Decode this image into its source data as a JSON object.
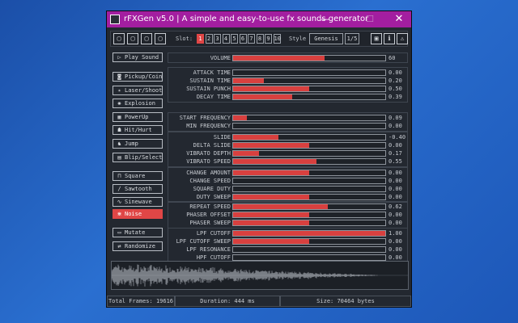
{
  "window": {
    "title": "rFXGen v5.0 | A simple and easy-to-use fx sounds generator",
    "controls": {
      "minimize": "—",
      "maximize": "☐",
      "close": "✕"
    }
  },
  "toolbar": {
    "file_buttons": [
      {
        "name": "new-file",
        "icon": "▢"
      },
      {
        "name": "open-file",
        "icon": "▢"
      },
      {
        "name": "save-file",
        "icon": "▢"
      },
      {
        "name": "export-file",
        "icon": "▢"
      }
    ],
    "slot_label": "Slot:",
    "slots": [
      "1",
      "2",
      "3",
      "4",
      "5",
      "6",
      "7",
      "8",
      "9",
      "10"
    ],
    "active_slot": 0,
    "style_label": "Style",
    "style_value": "Genesis",
    "style_page": "1/5",
    "right_buttons": [
      {
        "name": "screenshot-button",
        "icon": "▣"
      },
      {
        "name": "info-button",
        "icon": "ℹ"
      },
      {
        "name": "warning-button",
        "icon": "⚠"
      }
    ]
  },
  "sidebar": {
    "play": {
      "icon": "▷",
      "label": "Play Sound"
    },
    "generators": [
      {
        "icon": "◙",
        "label": "Pickup/Coin"
      },
      {
        "icon": "✴",
        "label": "Laser/Shoot"
      },
      {
        "icon": "✺",
        "label": "Explosion"
      },
      {
        "icon": "▦",
        "label": "PowerUp"
      },
      {
        "icon": "☗",
        "label": "Hit/Hurt"
      },
      {
        "icon": "♞",
        "label": "Jump"
      },
      {
        "icon": "▤",
        "label": "Blip/Select"
      }
    ],
    "waves": [
      {
        "icon": "⊓",
        "label": "Square"
      },
      {
        "icon": "∕",
        "label": "Sawtooth"
      },
      {
        "icon": "∿",
        "label": "Sinewave"
      },
      {
        "icon": "⋇",
        "label": "Noise"
      }
    ],
    "active_wave": 3,
    "mutate": {
      "icon": "▭",
      "label": "Mutate"
    },
    "randomize": {
      "icon": "⇄",
      "label": "Randomize"
    }
  },
  "volume": {
    "label": "VOLUME",
    "value": "60",
    "fill": 0.6
  },
  "groups": [
    {
      "name": "envelope",
      "sliders": [
        {
          "label": "ATTACK TIME",
          "value": "0.00",
          "fill": 0.0
        },
        {
          "label": "SUSTAIN TIME",
          "value": "0.20",
          "fill": 0.2
        },
        {
          "label": "SUSTAIN PUNCH",
          "value": "0.50",
          "fill": 0.5
        },
        {
          "label": "DECAY TIME",
          "value": "0.39",
          "fill": 0.39
        }
      ]
    },
    {
      "name": "frequency",
      "sliders": [
        {
          "label": "START FREQUENCY",
          "value": "0.09",
          "fill": 0.09
        },
        {
          "label": "MIN FREQUENCY",
          "value": "0.00",
          "fill": 0.0
        }
      ]
    },
    {
      "name": "slide",
      "sliders": [
        {
          "label": "SLIDE",
          "value": "-0.40",
          "fill": 0.3
        },
        {
          "label": "DELTA SLIDE",
          "value": "0.00",
          "fill": 0.5
        },
        {
          "label": "VIBRATO DEPTH",
          "value": "0.17",
          "fill": 0.17
        },
        {
          "label": "VIBRATO SPEED",
          "value": "0.55",
          "fill": 0.55
        }
      ]
    },
    {
      "name": "change",
      "sliders": [
        {
          "label": "CHANGE AMOUNT",
          "value": "0.00",
          "fill": 0.5
        },
        {
          "label": "CHANGE SPEED",
          "value": "0.00",
          "fill": 0.0
        },
        {
          "label": "SQUARE DUTY",
          "value": "0.00",
          "fill": 0.0
        },
        {
          "label": "DUTY SWEEP",
          "value": "0.00",
          "fill": 0.5
        }
      ]
    },
    {
      "name": "repeat",
      "sliders": [
        {
          "label": "REPEAT SPEED",
          "value": "0.62",
          "fill": 0.62
        },
        {
          "label": "PHASER OFFSET",
          "value": "0.00",
          "fill": 0.5
        },
        {
          "label": "PHASER SWEEP",
          "value": "0.00",
          "fill": 0.5
        }
      ]
    },
    {
      "name": "filters",
      "sliders": [
        {
          "label": "LPF CUTOFF",
          "value": "1.00",
          "fill": 1.0
        },
        {
          "label": "LPF CUTOFF SWEEP",
          "value": "0.00",
          "fill": 0.5
        },
        {
          "label": "LPF RESONANCE",
          "value": "0.00",
          "fill": 0.0
        },
        {
          "label": "HPF CUTOFF",
          "value": "0.00",
          "fill": 0.0
        },
        {
          "label": "HPF CUTOFF SWEEP",
          "value": "0.00",
          "fill": 0.5
        }
      ]
    }
  ],
  "status": {
    "total_frames": "Total Frames: 19616",
    "duration": "Duration: 444 ms",
    "size": "Size: 70464 bytes"
  },
  "colors": {
    "accent": "#d8403f",
    "titlebar": "#a31ea0",
    "panel": "#232830",
    "text": "#c6cad0"
  }
}
